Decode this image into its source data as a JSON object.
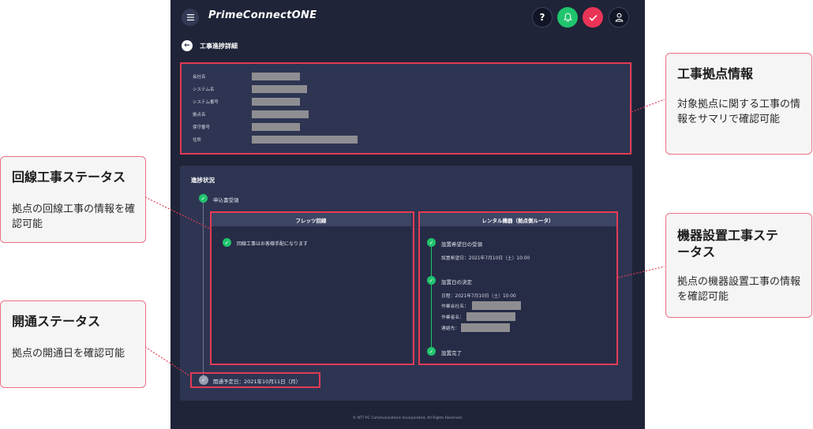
{
  "app": {
    "logo": "PrimeConnectONE",
    "help_label": "?",
    "page_title": "工事進捗詳細",
    "footer": "© NTT PC Communications Incorporated, All Rights Reserved."
  },
  "icons": {
    "menu": "hamburger-icon",
    "help": "question-icon",
    "bell": "bell-icon",
    "check": "check-icon",
    "user": "user-icon",
    "back": "arrow-left-icon"
  },
  "colors": {
    "app_bg": "#1f2438",
    "panel_bg": "#2e3552",
    "ok_green": "#20c46d",
    "alert_red": "#ea3457",
    "highlight_red": "#e33b56"
  },
  "site_info": {
    "labels": [
      "会社名",
      "システム名",
      "システム番号",
      "拠点名",
      "保守番号",
      "住所"
    ]
  },
  "progress": {
    "title": "進捗状況",
    "first_step": "申込書受領",
    "line_card": {
      "header": "フレッツ回線",
      "status": "回線工事はお客様手配になります"
    },
    "rental_card": {
      "header": "レンタル機器（拠点側ルータ）",
      "step1_title": "設置希望日の受領",
      "step1_detail": "設置希望日：2021年7月10日（土）10:00",
      "step2_title": "設置日の決定",
      "step2_schedule": "日程：2021年7月10日（土）10:00",
      "step2_company_label": "作業会社名：",
      "step2_worker_label": "作業者名：",
      "step2_contact_label": "連絡先：",
      "step3_title": "設置完了"
    },
    "opening": "開通予定日：2021年10月11日（月）"
  },
  "callouts": {
    "site_info": {
      "title": "工事拠点情報",
      "body": "対象拠点に関する工事の情報をサマリで確認可能"
    },
    "line_status": {
      "title": "回線工事ステータス",
      "body": "拠点の回線工事の情報を確認可能"
    },
    "equipment_status": {
      "title": "機器設置工事ステータス",
      "body": "拠点の機器設置工事の情報を確認可能"
    },
    "opening_status": {
      "title": "開通ステータス",
      "body": "拠点の開通日を確認可能"
    }
  }
}
